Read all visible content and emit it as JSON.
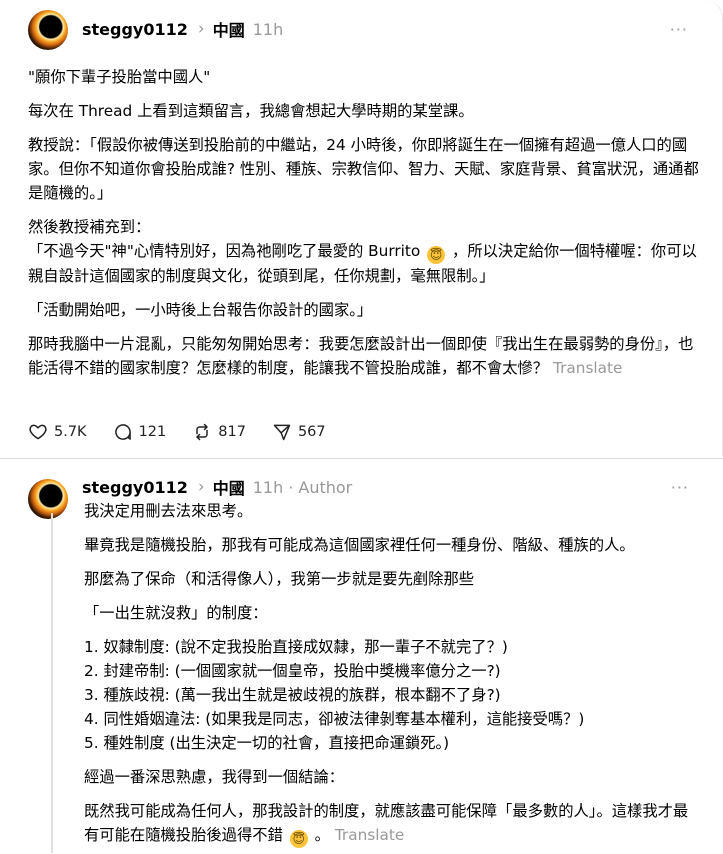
{
  "post1": {
    "username": "steggy0112",
    "chevron": "›",
    "place": "中國",
    "time": "11h",
    "more": "···",
    "paragraphs": [
      "\"願你下輩子投胎當中國人\"",
      "每次在 Thread 上看到這類留言，我總會想起大學時期的某堂課。",
      "教授說：「假設你被傳送到投胎前的中繼站，24 小時後，你即將誕生在一個擁有超過一億人口的國家。但你不知道你會投胎成誰? 性別、種族、宗教信仰、智力、天賦、家庭背景、貧富狀況，通通都是隨機的。」"
    ],
    "p4_line1": "然後教授補充到：",
    "p4_line2a": "「不過今天\"神\"心情特別好，因為祂剛吃了最愛的 Burrito",
    "emoji": "😇",
    "p4_line2b": "，所以決定給你一個特權喔：你可以親自設計這個國家的制度與文化，從頭到尾，任你規劃，毫無限制。」",
    "p5": "「活動開始吧，一小時後上台報告你設計的國家。」",
    "p6": "那時我腦中一片混亂，只能匆匆開始思考：我要怎麼設計出一個即使『我出生在最弱勢的身份』，也能活得不錯的國家制度？怎麼樣的制度，能讓我不管投胎成誰，都不會太慘？",
    "translate": "Translate",
    "likes": "5.7K",
    "replies": "121",
    "reposts": "817",
    "shares": "567"
  },
  "post2": {
    "username": "steggy0112",
    "chevron": "›",
    "place": "中國",
    "time": "11h",
    "author_label": "· Author",
    "more": "···",
    "intro": "我決定用刪去法來思考。",
    "p1": "畢竟我是隨機投胎，那我有可能成為這個國家裡任何一種身份、階級、種族的人。",
    "p2": "那麼為了保命（和活得像人），我第一步就是要先剷除那些",
    "p3": "「一出生就沒救」的制度：",
    "list": [
      "1. 奴隸制度: (說不定我投胎直接成奴隸，那一輩子不就完了？)",
      "2. 封建帝制: (一個國家就一個皇帝，投胎中獎機率億分之一?)",
      "3. 種族歧視: (萬一我出生就是被歧視的族群，根本翻不了身?)",
      "4. 同性婚姻違法: (如果我是同志，卻被法律剝奪基本權利，這能接受嗎？)",
      "5. 種姓制度 (出生決定一切的社會，直接把命運鎖死。)"
    ],
    "p4": "經過一番深思熟慮，我得到一個結論：",
    "p5a": "既然我可能成為任何人，那我設計的制度，就應該盡可能保障「最多數的人」。這樣我才最有可能在隨機投胎後過得不錯",
    "emoji": "😇",
    "p5b": "。",
    "translate": "Translate"
  },
  "colors": {
    "muted": "#999999",
    "text": "#000000",
    "divider": "#dcdcdc"
  },
  "icons": [
    "heart-icon",
    "comment-icon",
    "repost-icon",
    "share-icon",
    "chevron-right-icon",
    "more-icon"
  ]
}
